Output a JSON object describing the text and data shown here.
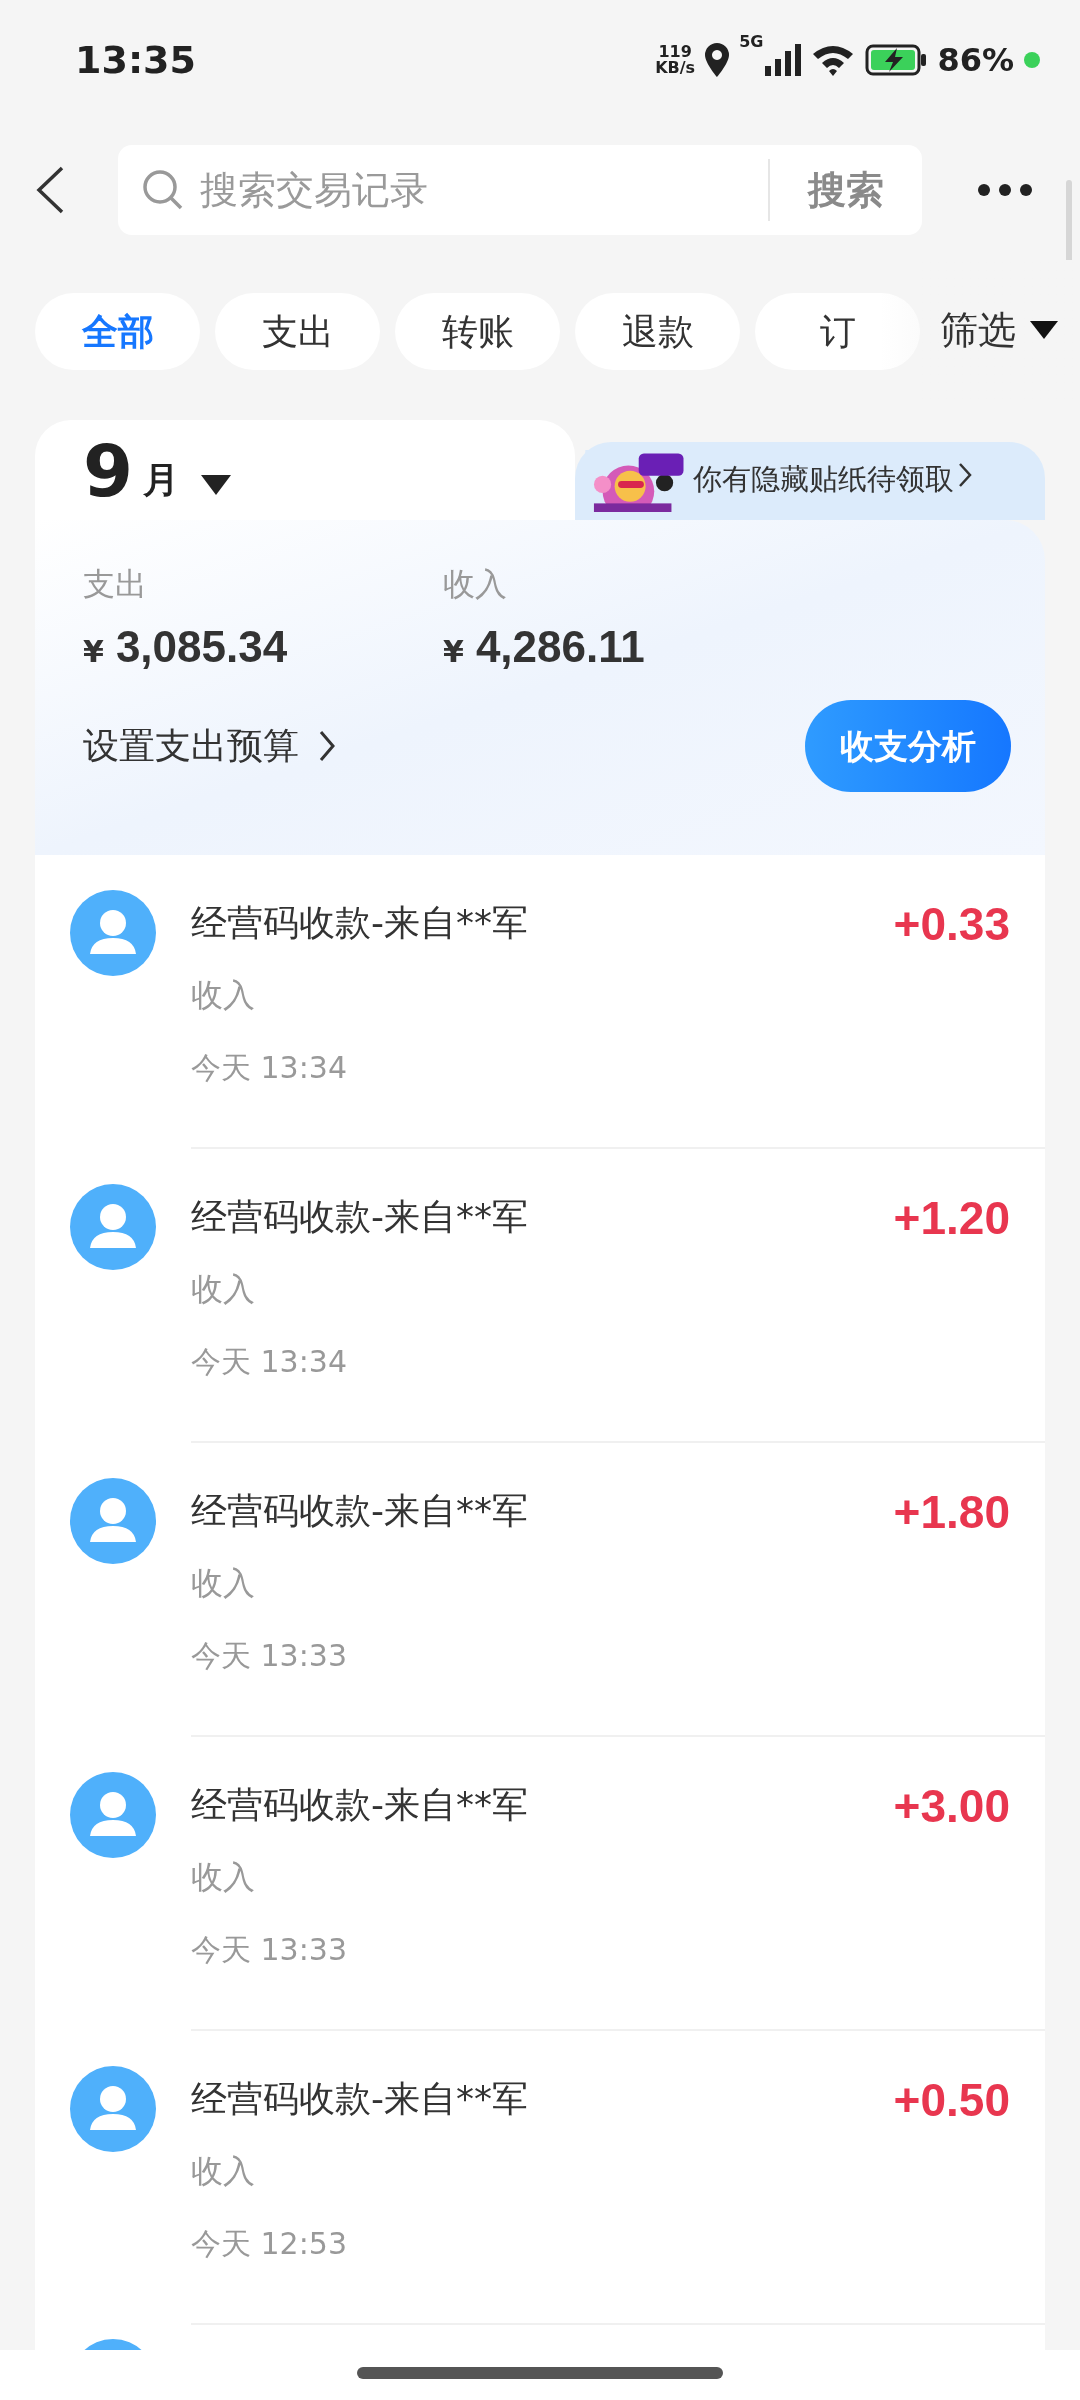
{
  "status_bar": {
    "time": "13:35",
    "speed_value": "119",
    "speed_unit": "KB/s",
    "network": "5G",
    "battery": "86%"
  },
  "search": {
    "placeholder": "搜索交易记录",
    "button": "搜索"
  },
  "filters": [
    {
      "label": "全部",
      "selected": true
    },
    {
      "label": "支出",
      "selected": false
    },
    {
      "label": "转账",
      "selected": false
    },
    {
      "label": "退款",
      "selected": false
    },
    {
      "label": "订",
      "selected": false
    }
  ],
  "filter_button": "筛选",
  "summary": {
    "month_number": "9",
    "month_unit": "月",
    "sticker_banner": "你有隐藏贴纸待领取",
    "expense_label": "支出",
    "expense_currency": "¥",
    "expense_amount": "3,085.34",
    "income_label": "收入",
    "income_currency": "¥",
    "income_amount": "4,286.11",
    "budget_link": "设置支出预算",
    "analysis_button": "收支分析"
  },
  "transactions": [
    {
      "title": "经营码收款-来自**军",
      "category": "收入",
      "time": "今天 13:34",
      "amount": "+0.33"
    },
    {
      "title": "经营码收款-来自**军",
      "category": "收入",
      "time": "今天 13:34",
      "amount": "+1.20"
    },
    {
      "title": "经营码收款-来自**军",
      "category": "收入",
      "time": "今天 13:33",
      "amount": "+1.80"
    },
    {
      "title": "经营码收款-来自**军",
      "category": "收入",
      "time": "今天 13:33",
      "amount": "+3.00"
    },
    {
      "title": "经营码收款-来自**军",
      "category": "收入",
      "time": "今天 12:53",
      "amount": "+0.50"
    }
  ]
}
